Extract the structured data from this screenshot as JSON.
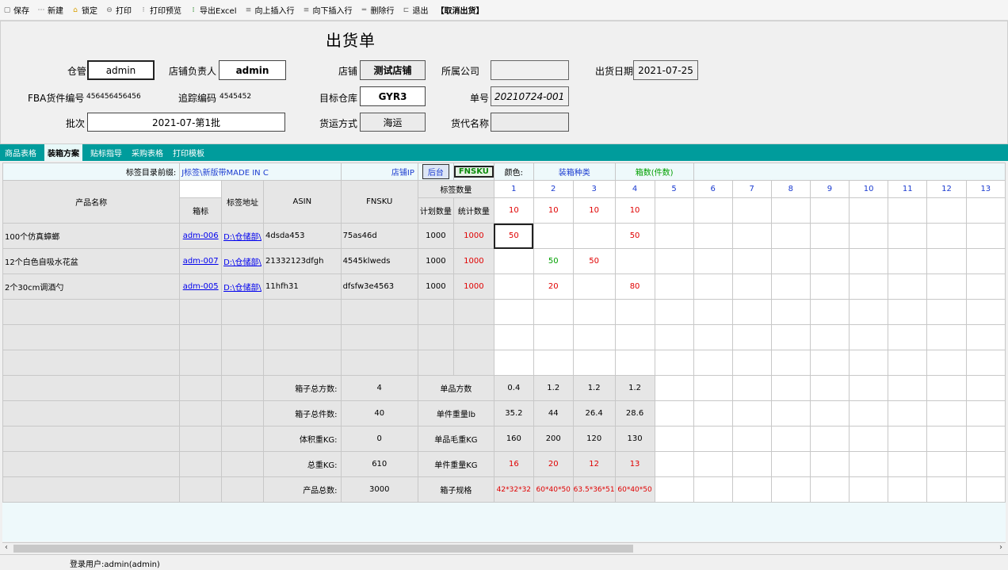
{
  "toolbar": {
    "items": [
      {
        "icon": "save-icon",
        "label": "保存"
      },
      {
        "icon": "new-icon",
        "label": "新建"
      },
      {
        "icon": "lock-icon",
        "label": "锁定"
      },
      {
        "icon": "print-icon",
        "label": "打印"
      },
      {
        "icon": "print-preview-icon",
        "label": "打印预览"
      },
      {
        "icon": "excel-icon",
        "label": "导出Excel"
      },
      {
        "icon": "insert-above-icon",
        "label": "向上插入行"
      },
      {
        "icon": "insert-below-icon",
        "label": "向下插入行"
      },
      {
        "icon": "delete-row-icon",
        "label": "删除行"
      },
      {
        "icon": "exit-icon",
        "label": "退出"
      }
    ],
    "cancel_label": "【取消出货】"
  },
  "form": {
    "title": "出货单",
    "warehouse_manager_label": "仓管",
    "warehouse_manager_value": "admin",
    "store_owner_label": "店铺负责人",
    "store_owner_value": "admin",
    "store_label": "店铺",
    "store_value": "测试店铺",
    "company_label": "所属公司",
    "company_value": "",
    "ship_date_label": "出货日期",
    "ship_date_value": "2021-07-25",
    "fba_label": "FBA货件编号",
    "fba_value": "456456456456",
    "tracking_label": "追踪编码",
    "tracking_value": "4545452",
    "target_wh_label": "目标仓库",
    "target_wh_value": "GYR3",
    "order_no_label": "单号",
    "order_no_value": "20210724-001",
    "batch_label": "批次",
    "batch_value": "2021-07-第1批",
    "ship_method_label": "货运方式",
    "ship_method_value": "海运",
    "forwarder_label": "货代名称",
    "forwarder_value": ""
  },
  "tabs": [
    "商品表格",
    "装箱方案",
    "贴标指导",
    "采购表格",
    "打印模板"
  ],
  "sheet": {
    "prefix_label": "标签目录前缀:",
    "prefix_value": "J标签\\新版带MADE IN C",
    "store_ip": "店铺IP",
    "backend_btn": "后台",
    "fnsku_btn": "FNSKU",
    "color_label": "颜色:",
    "box_type_label": "装箱种类",
    "box_count_label": "箱数(件数)",
    "col_product": "产品名称",
    "col_box_label": "箱标",
    "col_label_addr": "标签地址",
    "col_asin": "ASIN",
    "col_fnsku": "FNSKU",
    "col_label_qty": "标签数量",
    "col_plan_qty": "计划数量",
    "col_stat_qty": "统计数量",
    "box_numbers": [
      "1",
      "2",
      "3",
      "4",
      "5",
      "6",
      "7",
      "8",
      "9",
      "10",
      "11",
      "12",
      "13"
    ],
    "box_qty_row": [
      "10",
      "10",
      "10",
      "10",
      "",
      "",
      "",
      "",
      "",
      "",
      "",
      "",
      ""
    ],
    "rows": [
      {
        "name": "100个仿真蟑螂",
        "box_label": "adm-006",
        "addr": "D:\\仓储部\\",
        "asin": "4dsda453",
        "fnsku": "75as46d",
        "plan": "1000",
        "stat": "1000",
        "boxes": [
          "50",
          "",
          "",
          "50",
          "",
          "",
          "",
          "",
          "",
          "",
          "",
          "",
          ""
        ]
      },
      {
        "name": "12个白色自吸水花盆",
        "box_label": "adm-007",
        "addr": "D:\\仓储部\\",
        "asin": "21332123dfgh",
        "fnsku": "4545klweds",
        "plan": "1000",
        "stat": "1000",
        "boxes": [
          "",
          "50",
          "50",
          "",
          "",
          "",
          "",
          "",
          "",
          "",
          "",
          "",
          ""
        ]
      },
      {
        "name": "2个30cm调酒勺",
        "box_label": "adm-005",
        "addr": "D:\\仓储部\\",
        "asin": "11hfh31",
        "fnsku": "dfsfw3e4563",
        "plan": "1000",
        "stat": "1000",
        "boxes": [
          "",
          "20",
          "",
          "80",
          "",
          "",
          "",
          "",
          "",
          "",
          "",
          "",
          ""
        ]
      }
    ],
    "summary": [
      {
        "label": "箱子总方数:",
        "value": "4",
        "unit_label": "单品方数",
        "vals": [
          "0.4",
          "1.2",
          "1.2",
          "1.2"
        ]
      },
      {
        "label": "箱子总件数:",
        "value": "40",
        "unit_label": "单件重量lb",
        "vals": [
          "35.2",
          "44",
          "26.4",
          "28.6"
        ]
      },
      {
        "label": "体积重KG:",
        "value": "0",
        "unit_label": "单品毛重KG",
        "vals": [
          "160",
          "200",
          "120",
          "130"
        ]
      },
      {
        "label": "总重KG:",
        "value": "610",
        "unit_label": "单件重量KG",
        "vals": [
          "16",
          "20",
          "12",
          "13"
        ]
      },
      {
        "label": "产品总数:",
        "value": "3000",
        "unit_label": "箱子规格",
        "vals": [
          "42*32*32",
          "60*40*50",
          "63.5*36*51",
          "60*40*50"
        ]
      }
    ]
  },
  "status": {
    "user": "登录用户:admin(admin)"
  }
}
